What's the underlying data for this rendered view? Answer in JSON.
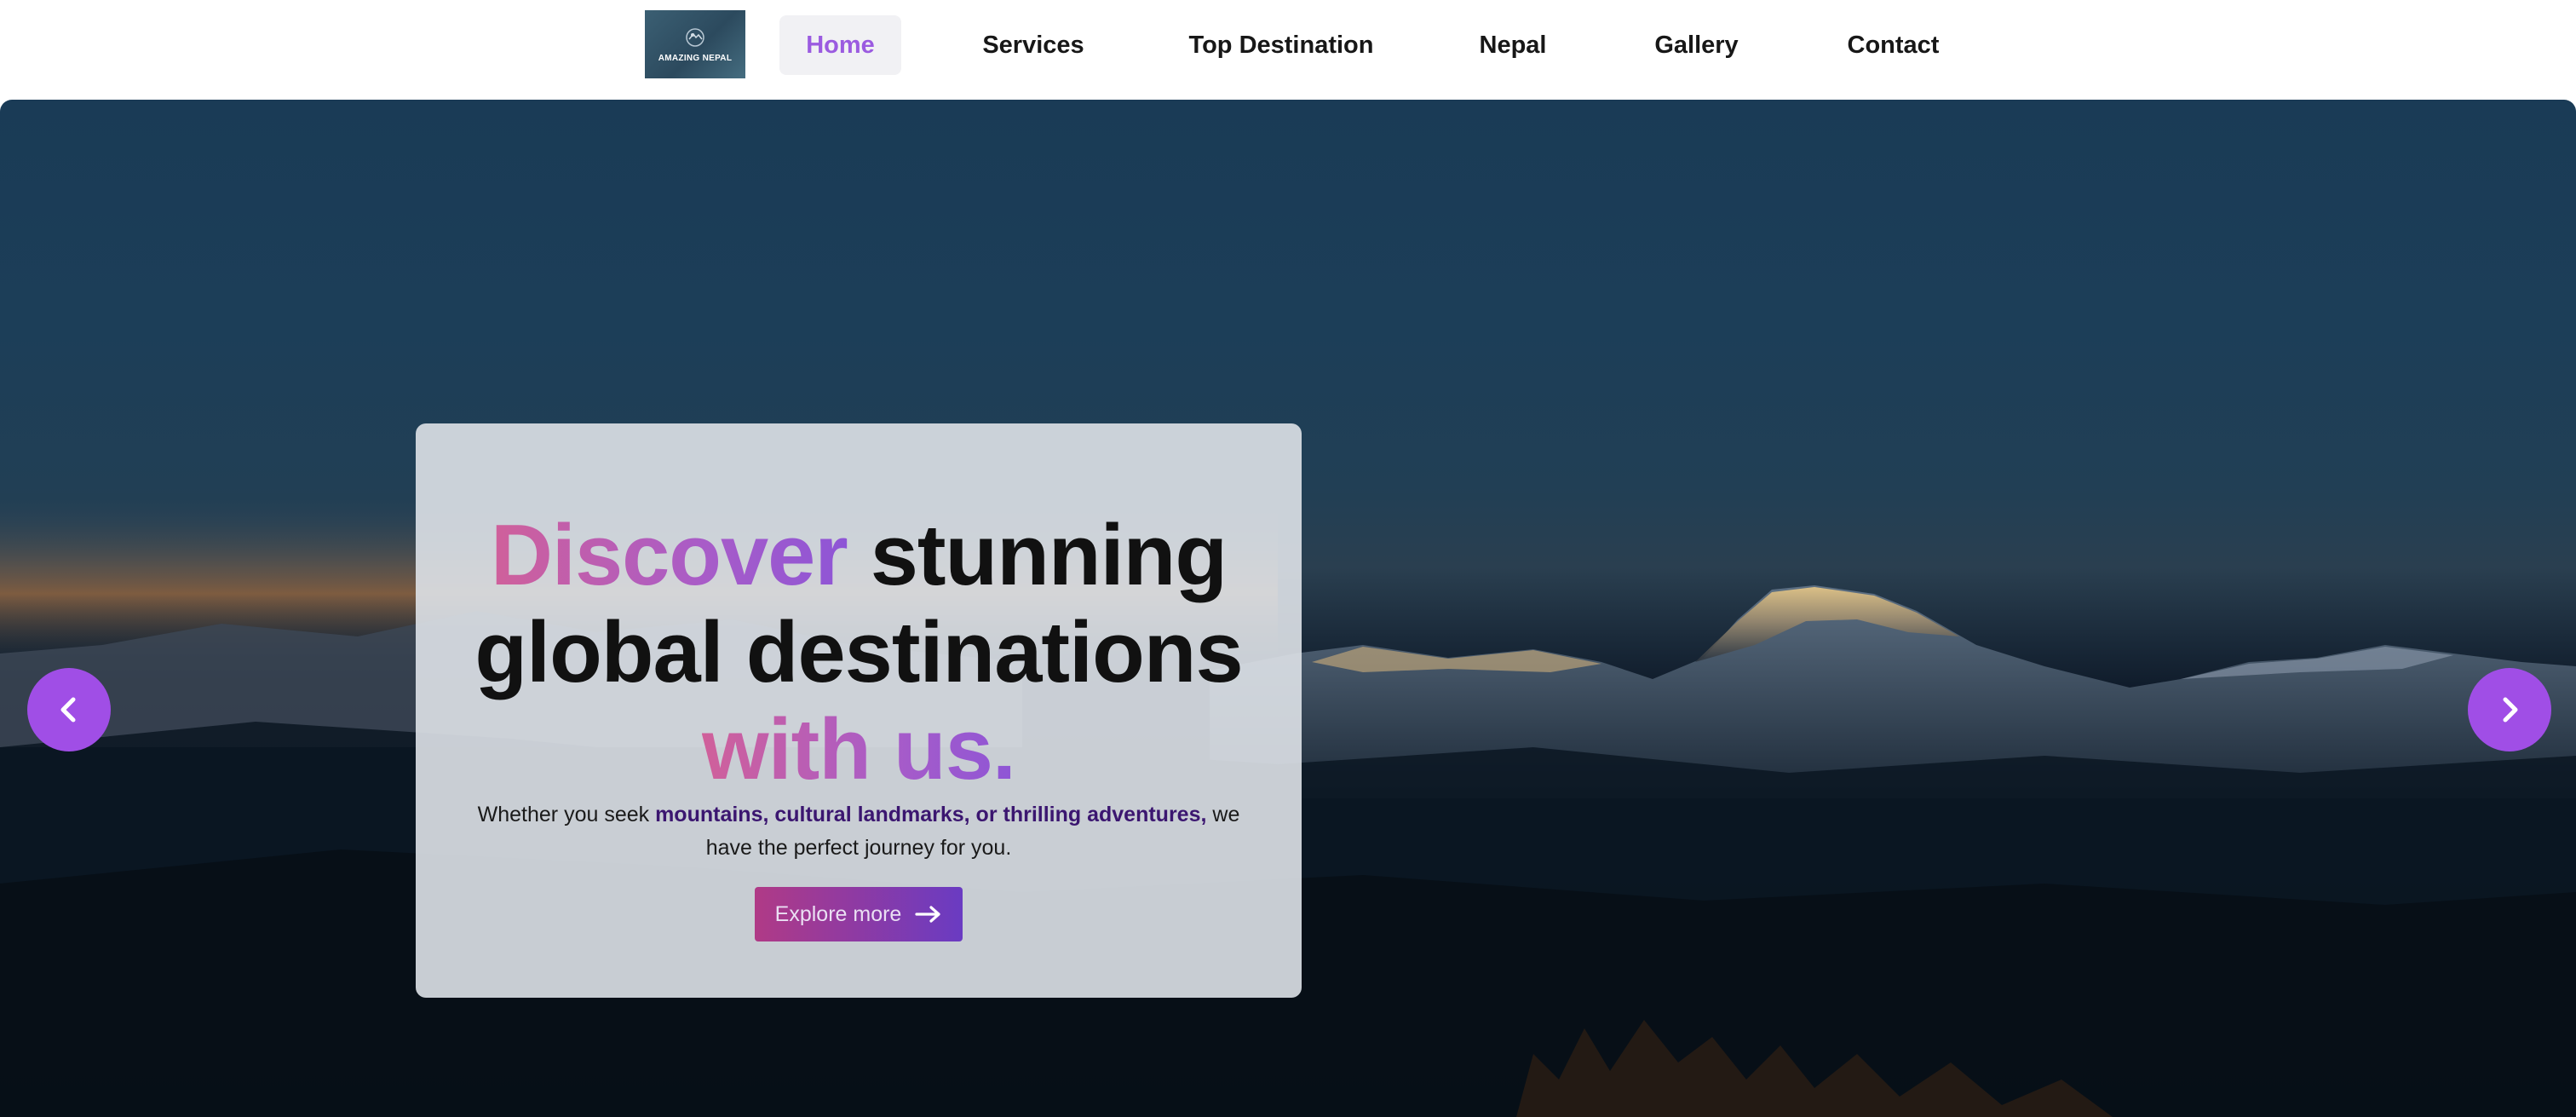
{
  "nav": {
    "logo_text": "AMAZING NEPAL",
    "items": [
      {
        "label": "Home",
        "active": true
      },
      {
        "label": "Services",
        "active": false
      },
      {
        "label": "Top Destination",
        "active": false
      },
      {
        "label": "Nepal",
        "active": false
      },
      {
        "label": "Gallery",
        "active": false
      },
      {
        "label": "Contact",
        "active": false
      }
    ]
  },
  "hero": {
    "headline": {
      "part1": "Discover",
      "part2": " stunning global destinations ",
      "part3": "with us."
    },
    "subtext": {
      "before": "Whether you seek ",
      "highlight": "mountains, cultural landmarks, or thrilling adventures,",
      "after": " we have the perfect journey for you."
    },
    "cta_label": "Explore more",
    "prev_icon": "chevron-left-icon",
    "next_icon": "chevron-right-icon"
  },
  "colors": {
    "accent": "#a04ee6",
    "active_nav": "#9b5be0",
    "gradient_start": "#d0609a",
    "gradient_end": "#8e55d6",
    "highlight_text": "#3b1670"
  }
}
